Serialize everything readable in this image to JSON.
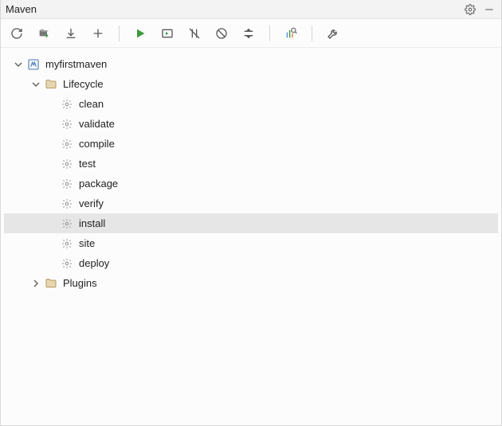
{
  "titlebar": {
    "title": "Maven"
  },
  "toolbar_buttons": [
    {
      "name": "reload-all-projects",
      "icon": "refresh"
    },
    {
      "name": "generate-sources",
      "icon": "folders"
    },
    {
      "name": "download-sources",
      "icon": "download"
    },
    {
      "name": "add-maven-project",
      "icon": "plus"
    },
    {
      "name": "sep"
    },
    {
      "name": "run-maven-build",
      "icon": "run"
    },
    {
      "name": "run-configurations",
      "icon": "run-config"
    },
    {
      "name": "toggle-offline-mode",
      "icon": "offline"
    },
    {
      "name": "toggle-skip-tests",
      "icon": "skip-tests"
    },
    {
      "name": "collapse-all",
      "icon": "collapse"
    },
    {
      "name": "sep"
    },
    {
      "name": "show-dependencies",
      "icon": "deps"
    },
    {
      "name": "sep"
    },
    {
      "name": "maven-settings",
      "icon": "wrench"
    }
  ],
  "tree": {
    "project": {
      "label": "myfirstmaven",
      "expanded": true
    },
    "lifecycle": {
      "label": "Lifecycle",
      "expanded": true,
      "goals": [
        {
          "label": "clean",
          "selected": false
        },
        {
          "label": "validate",
          "selected": false
        },
        {
          "label": "compile",
          "selected": false
        },
        {
          "label": "test",
          "selected": false
        },
        {
          "label": "package",
          "selected": false
        },
        {
          "label": "verify",
          "selected": false
        },
        {
          "label": "install",
          "selected": true
        },
        {
          "label": "site",
          "selected": false
        },
        {
          "label": "deploy",
          "selected": false
        }
      ]
    },
    "plugins": {
      "label": "Plugins",
      "expanded": false
    }
  }
}
